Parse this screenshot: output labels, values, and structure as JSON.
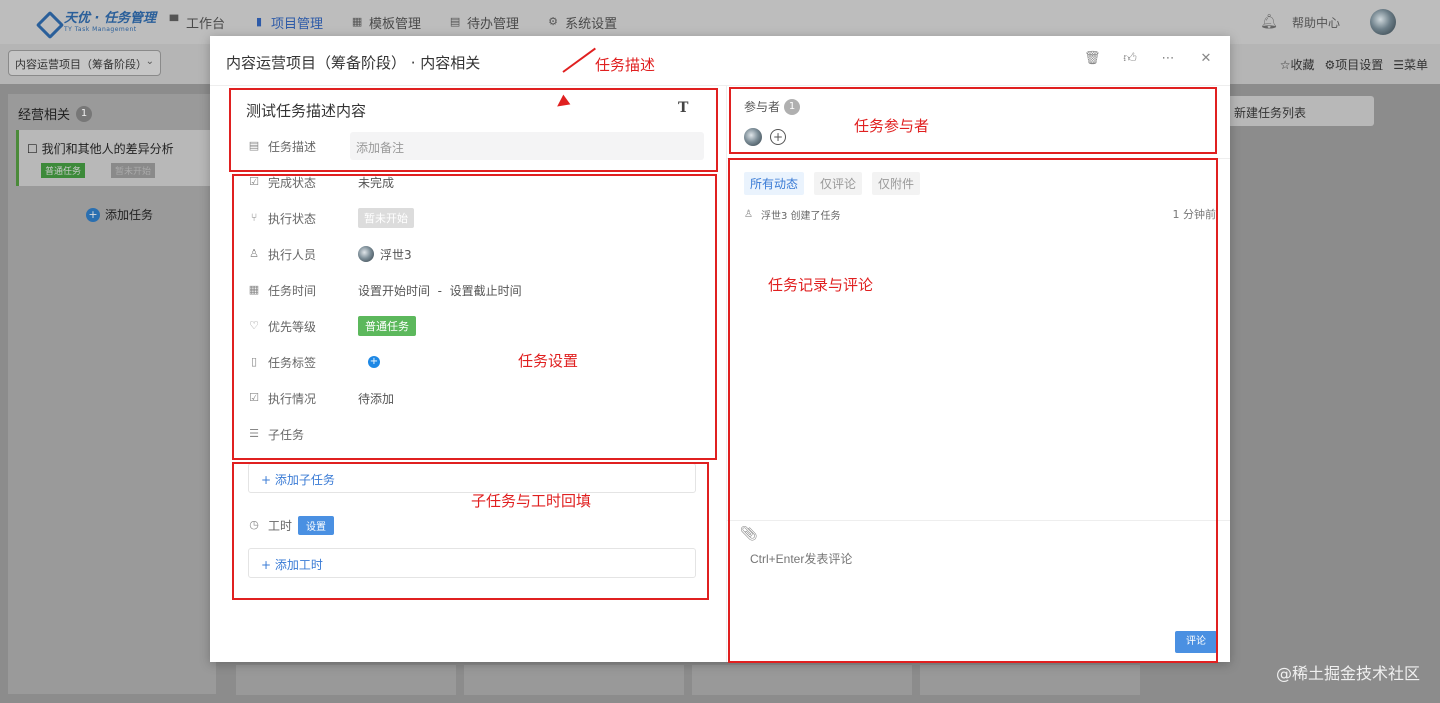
{
  "app": {
    "logo_text": "天优 · 任务管理",
    "logo_sub": "TY Task Management",
    "nav": [
      {
        "label": "工作台"
      },
      {
        "label": "项目管理"
      },
      {
        "label": "模板管理"
      },
      {
        "label": "待办管理"
      },
      {
        "label": "系统设置"
      }
    ],
    "help": "帮助中心"
  },
  "subbar": {
    "project_select": "内容运营项目（筹备阶段）",
    "favorite": "☆收藏",
    "project_settings": "⚙项目设置",
    "menu": "☰菜单"
  },
  "board": {
    "column_title": "经营相关",
    "column_count": "1",
    "card_title": "☐ 我们和其他人的差异分析",
    "card_tag1": "普通任务",
    "card_tag2": "暂未开始",
    "add_task": "添加任务",
    "new_list": "新建任务列表"
  },
  "modal": {
    "title": "内容运营项目（筹备阶段） · 内容相关",
    "task_title": "测试任务描述内容",
    "title_format_icon": "T",
    "description_label": "任务描述",
    "description_placeholder": "添加备注",
    "fields": {
      "done_label": "完成状态",
      "done_value": "未完成",
      "exec_label": "执行状态",
      "exec_value": "暂未开始",
      "assignee_label": "执行人员",
      "assignee_value": "浮世3",
      "time_label": "任务时间",
      "time_value": "设置开始时间  -  设置截止时间",
      "priority_label": "优先等级",
      "priority_value": "普通任务",
      "tags_label": "任务标签",
      "progress_label": "执行情况",
      "progress_value": "待添加",
      "subtask_label": "子任务"
    },
    "add_subtask": "+ 添加子任务",
    "worktime_label": "工时",
    "worktime_badge": "设置",
    "add_worktime": "+ 添加工时",
    "participants_label": "参与者",
    "participants_count": "1",
    "tabs": [
      "所有动态",
      "仅评论",
      "仅附件"
    ],
    "activity_text": "浮世3 创建了任务",
    "activity_time": "1 分钟前",
    "comment_placeholder": "Ctrl+Enter发表评论",
    "comment_button": "评论"
  },
  "annotations": {
    "desc": "任务描述",
    "participants": "任务参与者",
    "settings": "任务设置",
    "records": "任务记录与评论",
    "subtasks": "子任务与工时回填"
  },
  "watermark": "@稀土掘金技术社区",
  "colors": {
    "accent": "#3a7bd5",
    "annotation": "#e02020",
    "priority_green": "#5cb85c"
  }
}
